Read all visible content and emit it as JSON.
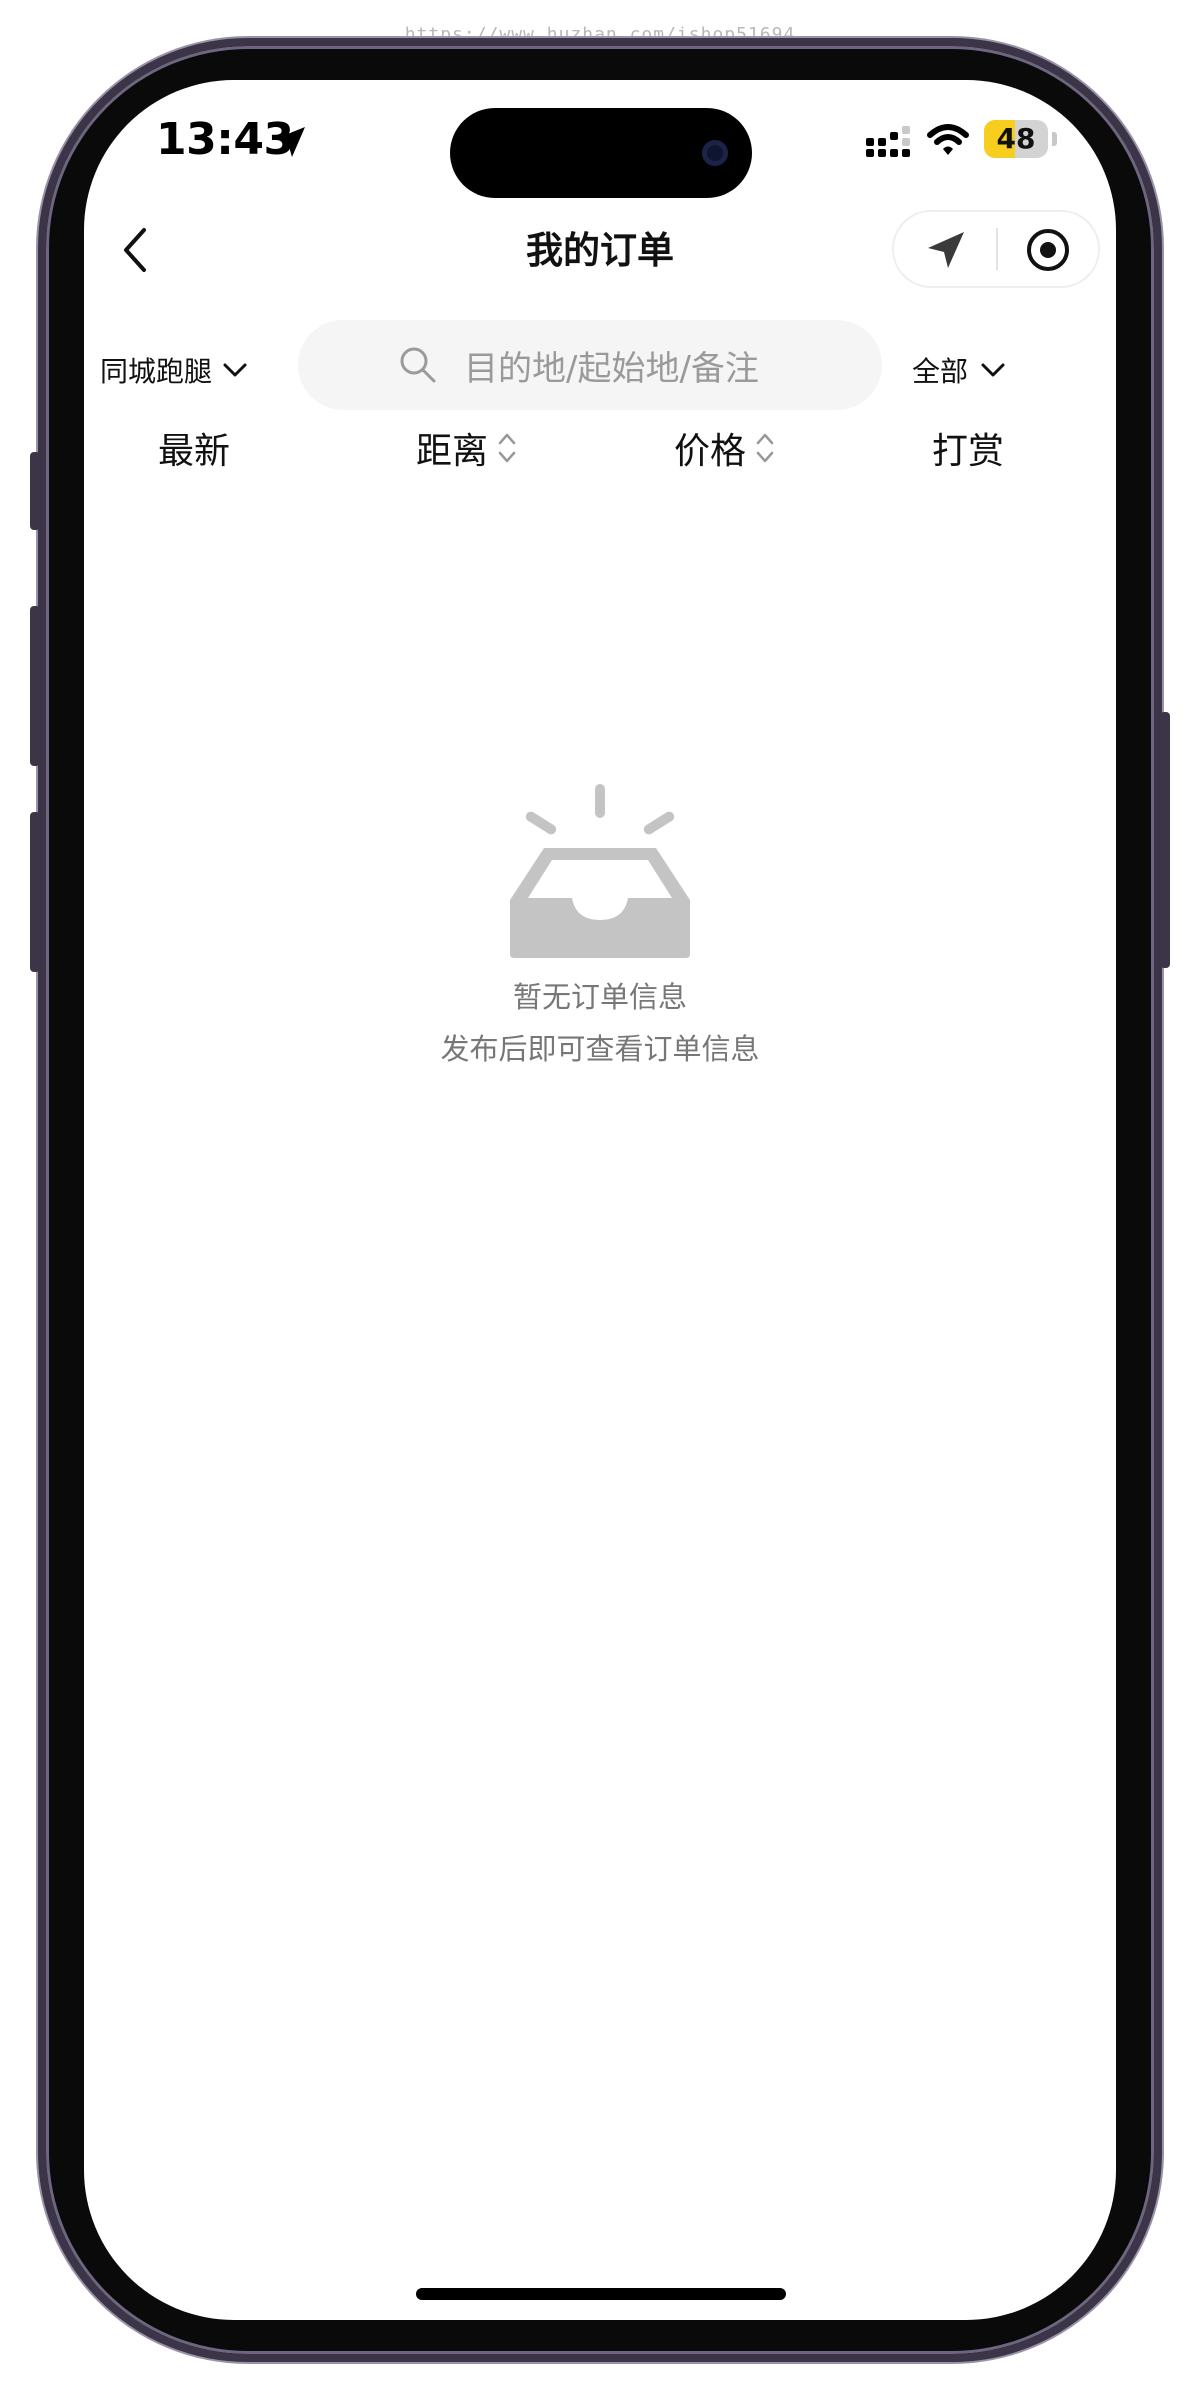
{
  "watermark": "https://www.huzhan.com/ishop51694",
  "status_bar": {
    "time": "13:43",
    "battery": "48",
    "battery_level": 0.48,
    "icons": [
      "location-arrow-icon",
      "signal-icon",
      "wifi-icon",
      "battery-icon"
    ]
  },
  "nav": {
    "title": "我的订单",
    "back_icon": "chevron-left-icon",
    "capsule_icons": [
      "location-arrow-icon",
      "target-icon"
    ]
  },
  "filters": {
    "category": "同城跑腿",
    "status": "全部",
    "search": {
      "placeholder": "目的地/起始地/备注",
      "icon": "search-icon"
    }
  },
  "sort_tabs": [
    {
      "label": "最新"
    },
    {
      "label": "距离"
    },
    {
      "label": "价格"
    },
    {
      "label": "打赏"
    }
  ],
  "empty_state": {
    "icon": "empty-inbox-icon",
    "line1": "暂无订单信息",
    "line2": "发布后即可查看订单信息"
  },
  "colors": {
    "battery_accent": "#f7ce1d",
    "muted_text": "#777777",
    "empty_icon": "#c4c4c4",
    "search_bg": "#f5f5f5"
  }
}
